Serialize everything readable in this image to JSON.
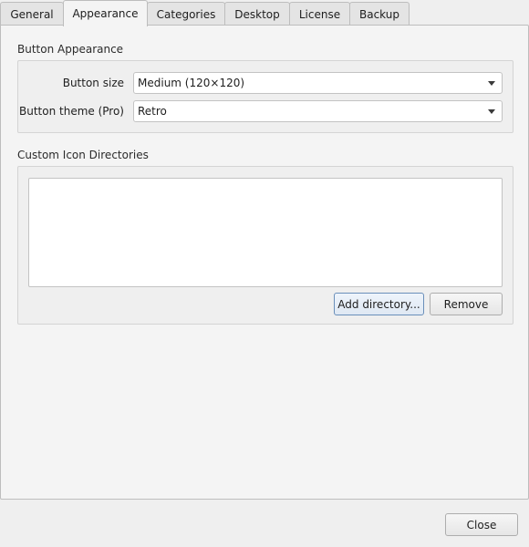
{
  "tabs": [
    {
      "label": "General"
    },
    {
      "label": "Appearance",
      "active": true
    },
    {
      "label": "Categories"
    },
    {
      "label": "Desktop"
    },
    {
      "label": "License"
    },
    {
      "label": "Backup"
    }
  ],
  "button_appearance": {
    "title": "Button Appearance",
    "size_label": "Button size",
    "size_value": "Medium (120×120)",
    "theme_label": "Button theme (Pro)",
    "theme_value": "Retro"
  },
  "icon_dirs": {
    "title": "Custom Icon Directories",
    "add_label": "Add directory...",
    "remove_label": "Remove"
  },
  "footer": {
    "close_label": "Close"
  },
  "icons": {
    "combo_arrow": "chevron-down-icon"
  }
}
